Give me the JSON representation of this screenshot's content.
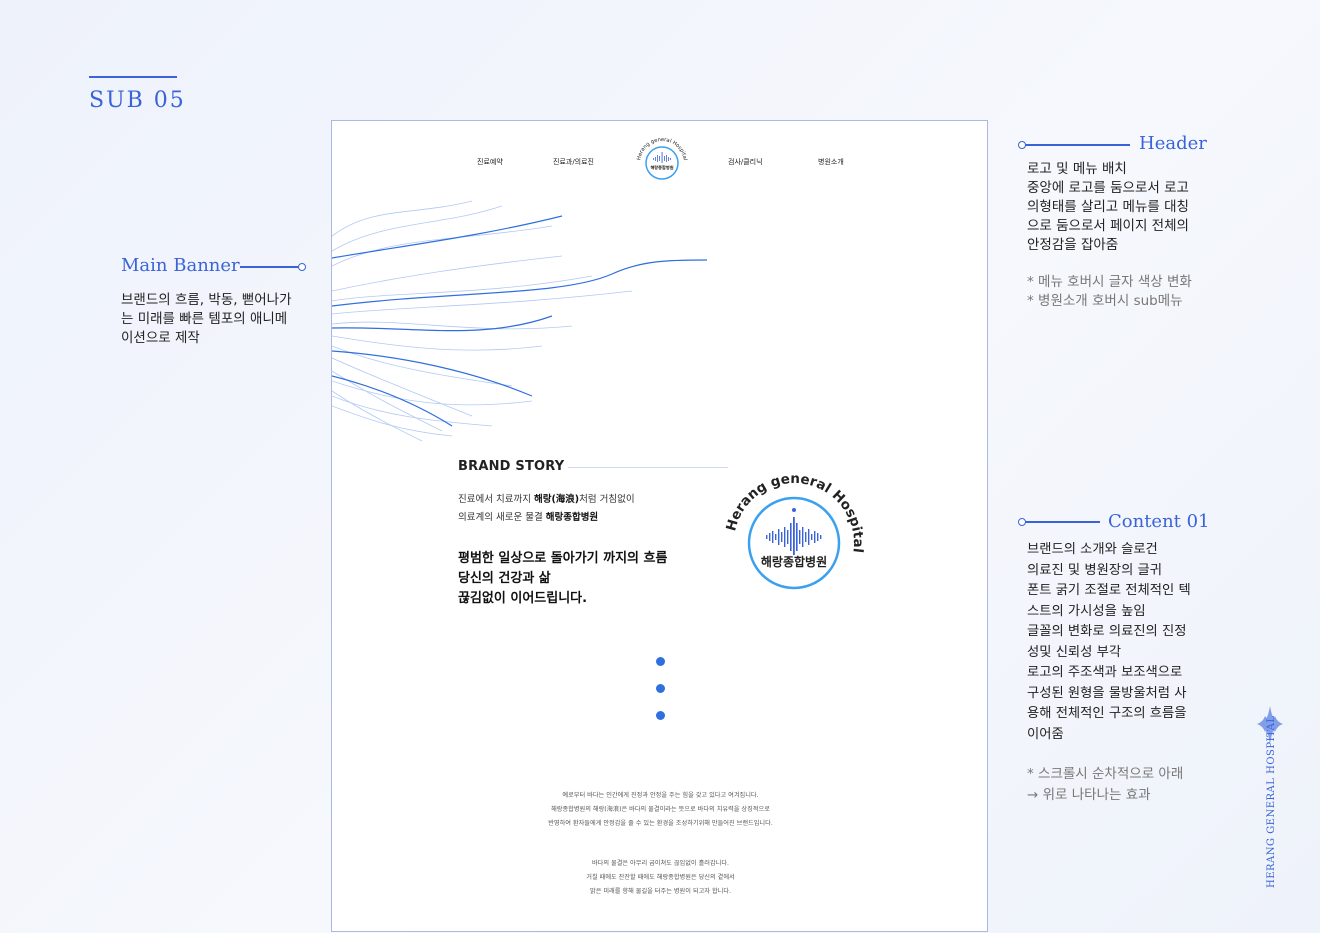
{
  "page_label": "SUB 05",
  "side_brand": "HERANG GENERAL HOSPITAL",
  "annotations": {
    "header": {
      "title": "Header",
      "body": "로고 및 메뉴 배치\n중앙에 로고를 둠으로서 로고\n의형태를 살리고 메뉴를 대칭\n으로 둠으로서 페이지 전체의\n안정감을 잡아줌",
      "notes": "* 메뉴 호버시 글자 색상 변화\n* 병원소개 호버시 sub메뉴"
    },
    "main_banner": {
      "title": "Main Banner",
      "body": "브랜드의 흐름, 박동, 뻗어나가\n는 미래를 빠른 템포의 애니메\n이션으로 제작"
    },
    "content01": {
      "title": "Content 01",
      "body": "브랜드의 소개와 슬로건\n의료진 및 병원장의 글귀\n폰트 굵기 조절로 전체적인 텍\n스트의 가시성을 높임\n글꼴의 변화로 의료진의 진정\n성및 신뢰성 부각\n로고의 주조색과 보조색으로\n구성된 원형을  물방울처럼 사\n용해 전체적인 구조의 흐름을\n이어줌",
      "notes": "* 스크롤시 순차적으로 아래\n→ 위로  나타나는 효과"
    }
  },
  "site": {
    "nav": {
      "left": [
        "진료예약",
        "진료과/의료진"
      ],
      "right": [
        "검사/클리닉",
        "병원소개"
      ]
    },
    "logo": {
      "ring_text": "Herang general Hospital",
      "name_ko": "해랑종합병원"
    },
    "brand_story": {
      "title": "BRAND STORY",
      "intro_line1_pre": "진료에서 치료까지 ",
      "intro_line1_bold": "해랑(海浪)",
      "intro_line1_post": "처럼 거침없이",
      "intro_line2_pre": "의료계의 새로운 물결 ",
      "intro_line2_bold": "해랑종합병원",
      "slogan": [
        "평범한 일상으로 돌아가기 까지의 흐름",
        "당신의 건강과 삶",
        "끊김없이 이어드립니다."
      ]
    },
    "footer_text": {
      "para1": [
        "예로부터 바다는 인간에게 진정과 안정을 주는 힘을 갖고 있다고 여겨집니다.",
        "해랑종합병원의 해랑(海浪)은 바다의 물결이라는 뜻으로 바다의 치유력을 상징적으로",
        "반영하여 환자들에게 안정감을 줄 수 있는 환경을 조성하기위해 만들어진 브랜드입니다."
      ],
      "para2": [
        "바다의 물결은 아무리 굽이쳐도 끊임없이 흘러갑니다.",
        "거칠 때에도 잔잔할 때에도 해랑종합병원은 당신의 곁에서",
        "밝은 미래를 향해 물길을 터주는 병원이 되고자 합니다."
      ]
    }
  },
  "colors": {
    "accent": "#3a63d8",
    "wave": "#2f6fe0",
    "light_wave": "#a9c3f3"
  }
}
